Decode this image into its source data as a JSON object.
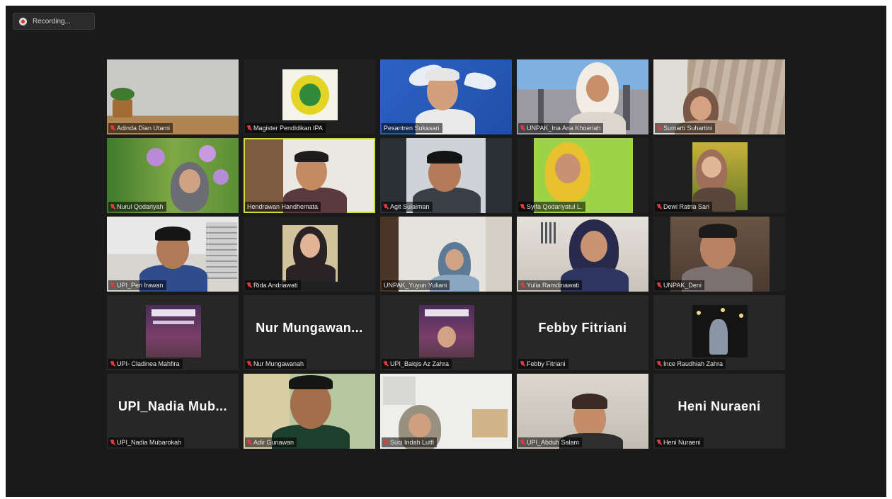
{
  "recording": {
    "label": "Recording..."
  },
  "participants": [
    {
      "name": "Adinda Dian Utami"
    },
    {
      "name": "Magister Pendidikan IPA"
    },
    {
      "name": "Pesantren Sukasari"
    },
    {
      "name": "UNPAK_Ina Ana Khoeriah"
    },
    {
      "name": "Sumarti Suhartini"
    },
    {
      "name": "Nurul Qodariyah"
    },
    {
      "name": "Hendrawan Handhemata"
    },
    {
      "name": "Agit Sulaiman"
    },
    {
      "name": "Syifa Qodariyatul L."
    },
    {
      "name": "Dewi Ratna Sari"
    },
    {
      "name": "UPI_Peri Irawan"
    },
    {
      "name": "Rida Andriawati"
    },
    {
      "name": "UNPAK_Yuyun Yuliani"
    },
    {
      "name": "Yulia Ramdinawati"
    },
    {
      "name": "UNPAK_Deni"
    },
    {
      "name": "UPI- Cladinea Mahfira"
    },
    {
      "name": "Nur Mungawanah",
      "display": "Nur  Mungawan..."
    },
    {
      "name": "UPI_Balqis Az Zahra"
    },
    {
      "name": "Febby Fitriani",
      "display": "Febby Fitriani"
    },
    {
      "name": "Ince Raudhiah Zahra"
    },
    {
      "name": "UPI_Nadia Mubarokah",
      "display": "UPI_Nadia  Mub..."
    },
    {
      "name": "Adir Gunawan"
    },
    {
      "name": "Suci Indah Lutfi"
    },
    {
      "name": "UPI_Abduh Salam"
    },
    {
      "name": "Heni Nuraeni",
      "display": "Heni Nuraeni"
    }
  ],
  "colors": {
    "background": "#1a1a1a",
    "tile": "#272727",
    "active_speaker": "#c9de45",
    "muted": "#e23b3b"
  }
}
